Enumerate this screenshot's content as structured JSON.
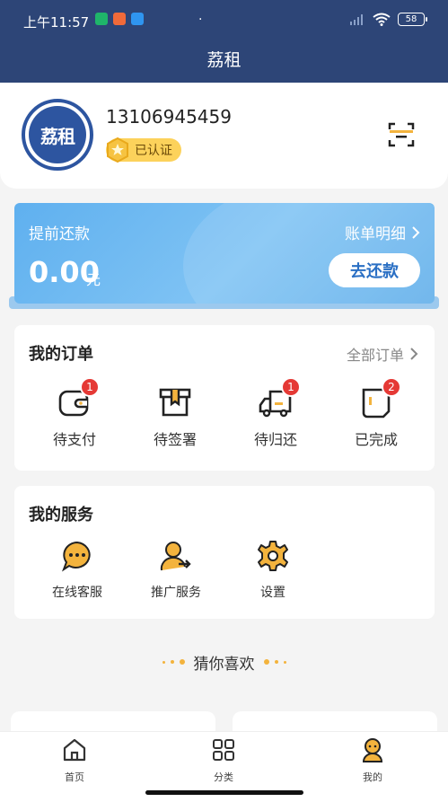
{
  "status_bar": {
    "time": "上午11:57",
    "battery": "58"
  },
  "header": {
    "title": "荔租"
  },
  "profile": {
    "avatar_text": "荔租",
    "phone": "13106945459",
    "verified_label": "已认证"
  },
  "repay": {
    "title": "提前还款",
    "bill_link": "账单明细",
    "amount": "0.00",
    "unit": "元",
    "button": "去还款"
  },
  "orders": {
    "title": "我的订单",
    "all_link": "全部订单",
    "items": [
      {
        "label": "待支付",
        "badge": "1",
        "icon": "wallet-icon"
      },
      {
        "label": "待签署",
        "badge": "",
        "icon": "box-icon"
      },
      {
        "label": "待归还",
        "badge": "1",
        "icon": "truck-icon"
      },
      {
        "label": "已完成",
        "badge": "2",
        "icon": "document-icon"
      }
    ]
  },
  "services": {
    "title": "我的服务",
    "items": [
      {
        "label": "在线客服",
        "icon": "chat-icon"
      },
      {
        "label": "推广服务",
        "icon": "promote-icon"
      },
      {
        "label": "设置",
        "icon": "gear-icon"
      }
    ]
  },
  "guess": {
    "title": "猜你喜欢"
  },
  "tabbar": {
    "items": [
      {
        "label": "首页",
        "icon": "home-icon"
      },
      {
        "label": "分类",
        "icon": "grid-icon"
      },
      {
        "label": "我的",
        "icon": "profile-icon"
      }
    ]
  },
  "colors": {
    "header_bg": "#2d4577",
    "accent": "#f3b33d",
    "repay_bg": "#6db9f1",
    "badge": "#e53935"
  }
}
